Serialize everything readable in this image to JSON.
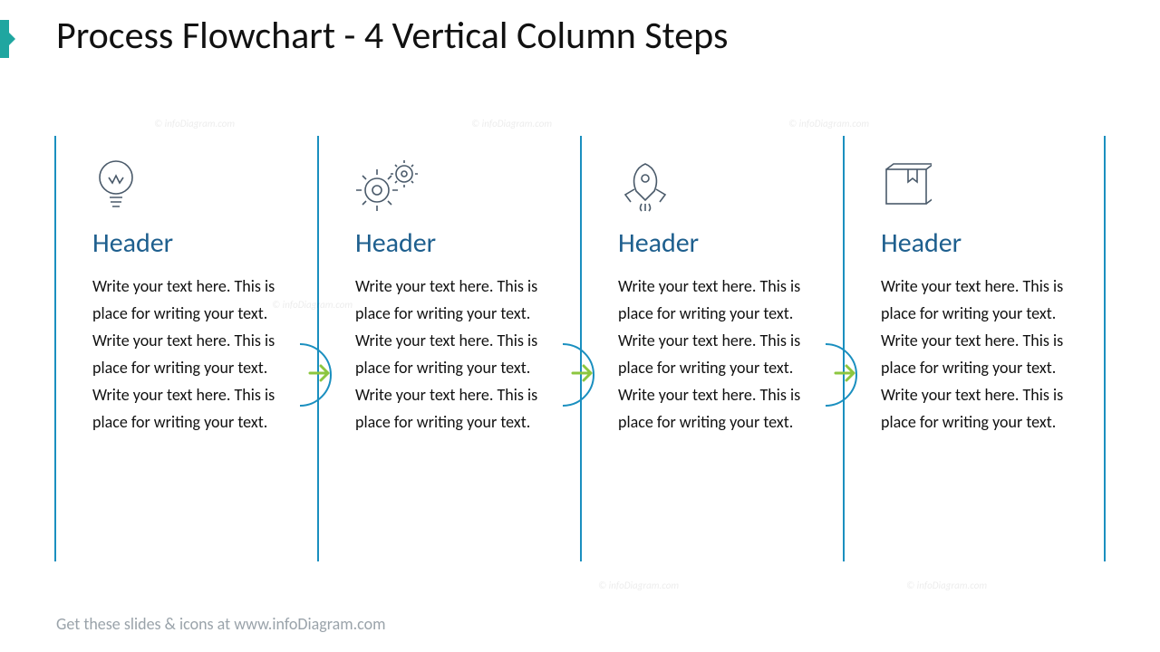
{
  "title": "Process Flowchart - 4 Vertical Column Steps",
  "columns": [
    {
      "header": "Header",
      "body": "Write your text here. This is place for writing your text. Write your text here. This is place for writing your text. Write your text here. This is place for writing your text."
    },
    {
      "header": "Header",
      "body": "Write your text here. This is place for writing your text. Write your text here. This is place for writing your text. Write your text here. This is place for writing your text."
    },
    {
      "header": "Header",
      "body": "Write your text here. This is place for writing your text. Write your text here. This is place for writing your text. Write your text here. This is place for writing your text."
    },
    {
      "header": "Header",
      "body": "Write your text here. This is place for writing your text. Write your text here. This is place for writing your text. Write your text here. This is place for writing your text."
    }
  ],
  "footer": "Get these slides & icons at www.infoDiagram.com",
  "watermark": "© infoDiagram.com"
}
